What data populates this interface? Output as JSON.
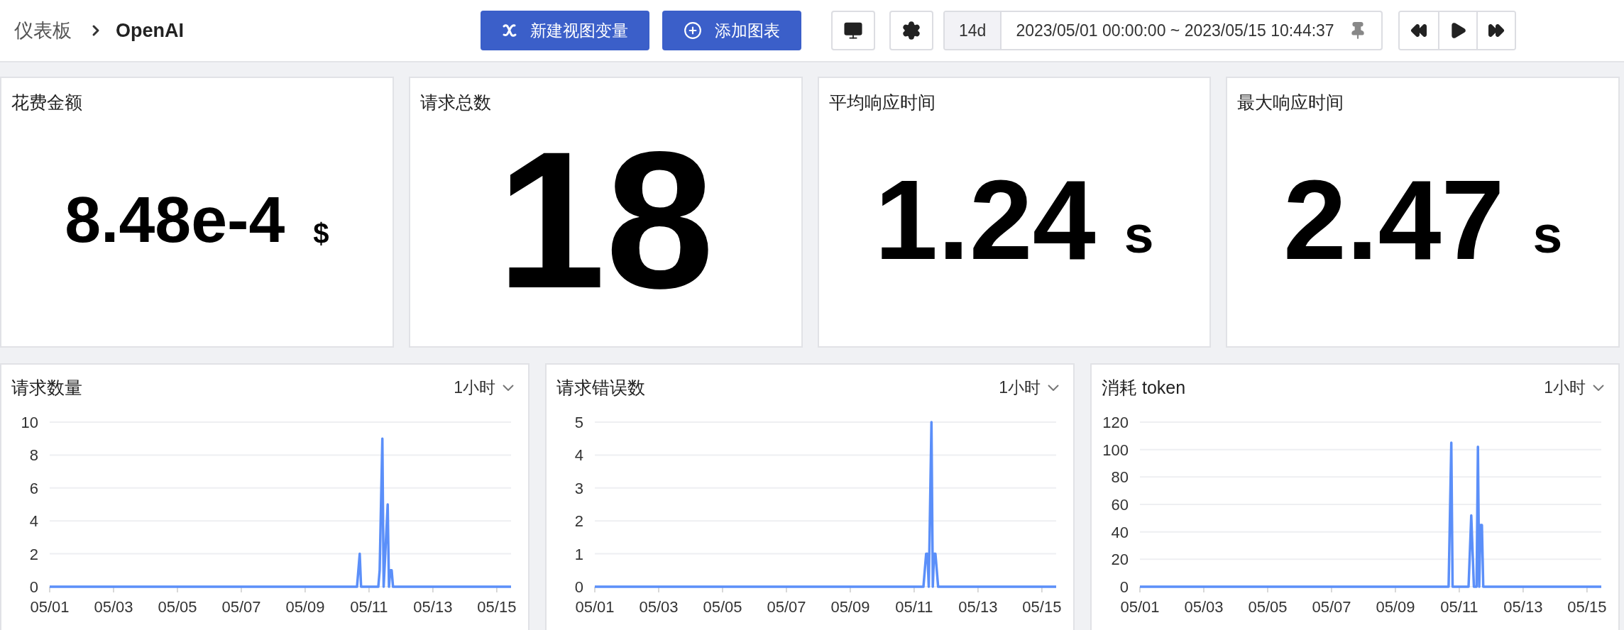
{
  "breadcrumb": {
    "parent": "仪表板",
    "current": "OpenAI"
  },
  "toolbar": {
    "buttons": [
      {
        "kind": "variable",
        "label": "新建视图变量"
      },
      {
        "kind": "add",
        "label": "添加图表"
      }
    ]
  },
  "time_range": {
    "shortcut": "14d",
    "value": "2023/05/01 00:00:00 ~ 2023/05/15 10:44:37"
  },
  "stats": [
    {
      "title": "花费金额",
      "value": "8.48e-4",
      "unit": "$"
    },
    {
      "title": "请求总数",
      "value": "18"
    },
    {
      "title": "平均响应时间",
      "value": "1.24",
      "unit": "s"
    },
    {
      "title": "最大响应时间",
      "value": "2.47",
      "unit": "s"
    }
  ],
  "charts": [
    {
      "title": "请求数量",
      "interval": "1小时",
      "chart_data": {
        "type": "line",
        "grid": true,
        "x": [
          "2023-05-01T00:00",
          "2023-05-10T15:00",
          "2023-05-10T17:00",
          "2023-05-10T18:00",
          "2023-05-11T07:00",
          "2023-05-11T08:00",
          "2023-05-11T10:00",
          "2023-05-11T11:00",
          "2023-05-11T14:00",
          "2023-05-11T15:00",
          "2023-05-11T16:00",
          "2023-05-11T17:00",
          "2023-05-11T18:00",
          "2023-05-15T10:44"
        ],
        "series": [
          {
            "color": "#5b8ff9",
            "values": [
              0,
              0,
              2,
              0,
              0,
              1,
              9,
              0,
              5,
              0,
              1,
              1,
              0,
              0
            ]
          }
        ],
        "xlim": [
          "2023-05-01T00:00",
          "2023-05-15T10:44"
        ],
        "ylim": [
          0,
          10
        ],
        "yticks": [
          0,
          2,
          4,
          6,
          8,
          10
        ],
        "xticks": [
          {
            "value": "2023-05-01T00:00",
            "label": "05/01"
          },
          {
            "value": "2023-05-03T00:00",
            "label": "05/03"
          },
          {
            "value": "2023-05-05T00:00",
            "label": "05/05"
          },
          {
            "value": "2023-05-07T00:00",
            "label": "05/07"
          },
          {
            "value": "2023-05-09T00:00",
            "label": "05/09"
          },
          {
            "value": "2023-05-11T00:00",
            "label": "05/11"
          },
          {
            "value": "2023-05-13T00:00",
            "label": "05/13"
          },
          {
            "value": "2023-05-15T00:00",
            "label": "05/15"
          }
        ]
      }
    },
    {
      "title": "请求错误数",
      "interval": "1小时",
      "chart_data": {
        "type": "line",
        "grid": true,
        "x": [
          "2023-05-01T00:00",
          "2023-05-11T07:00",
          "2023-05-11T09:00",
          "2023-05-11T10:00",
          "2023-05-11T11:00",
          "2023-05-11T13:00",
          "2023-05-11T14:00",
          "2023-05-11T15:00",
          "2023-05-11T16:00",
          "2023-05-11T18:00",
          "2023-05-15T10:44"
        ],
        "series": [
          {
            "color": "#5b8ff9",
            "values": [
              0,
              0,
              1,
              1,
              0,
              5,
              0,
              1,
              1,
              0,
              0
            ]
          }
        ],
        "xlim": [
          "2023-05-01T00:00",
          "2023-05-15T10:44"
        ],
        "ylim": [
          0,
          5
        ],
        "yticks": [
          0,
          1,
          2,
          3,
          4,
          5
        ],
        "xticks": [
          {
            "value": "2023-05-01T00:00",
            "label": "05/01"
          },
          {
            "value": "2023-05-03T00:00",
            "label": "05/03"
          },
          {
            "value": "2023-05-05T00:00",
            "label": "05/05"
          },
          {
            "value": "2023-05-07T00:00",
            "label": "05/07"
          },
          {
            "value": "2023-05-09T00:00",
            "label": "05/09"
          },
          {
            "value": "2023-05-11T00:00",
            "label": "05/11"
          },
          {
            "value": "2023-05-13T00:00",
            "label": "05/13"
          },
          {
            "value": "2023-05-15T00:00",
            "label": "05/15"
          }
        ]
      }
    },
    {
      "title": "消耗 token",
      "interval": "1小时",
      "chart_data": {
        "type": "line",
        "grid": true,
        "x": [
          "2023-05-01T00:00",
          "2023-05-10T16:00",
          "2023-05-10T18:00",
          "2023-05-10T19:00",
          "2023-05-11T07:00",
          "2023-05-11T09:00",
          "2023-05-11T11:00",
          "2023-05-11T13:00",
          "2023-05-11T14:00",
          "2023-05-11T15:00",
          "2023-05-11T16:00",
          "2023-05-11T17:00",
          "2023-05-11T18:00",
          "2023-05-15T10:44"
        ],
        "series": [
          {
            "color": "#5b8ff9",
            "values": [
              0,
              0,
              105,
              0,
              0,
              52,
              0,
              0,
              102,
              0,
              45,
              45,
              0,
              0
            ]
          }
        ],
        "xlim": [
          "2023-05-01T00:00",
          "2023-05-15T10:44"
        ],
        "ylim": [
          0,
          120
        ],
        "yticks": [
          0,
          20,
          40,
          60,
          80,
          100,
          120
        ],
        "xticks": [
          {
            "value": "2023-05-01T00:00",
            "label": "05/01"
          },
          {
            "value": "2023-05-03T00:00",
            "label": "05/03"
          },
          {
            "value": "2023-05-05T00:00",
            "label": "05/05"
          },
          {
            "value": "2023-05-07T00:00",
            "label": "05/07"
          },
          {
            "value": "2023-05-09T00:00",
            "label": "05/09"
          },
          {
            "value": "2023-05-11T00:00",
            "label": "05/11"
          },
          {
            "value": "2023-05-13T00:00",
            "label": "05/13"
          },
          {
            "value": "2023-05-15T00:00",
            "label": "05/15"
          }
        ]
      }
    }
  ]
}
